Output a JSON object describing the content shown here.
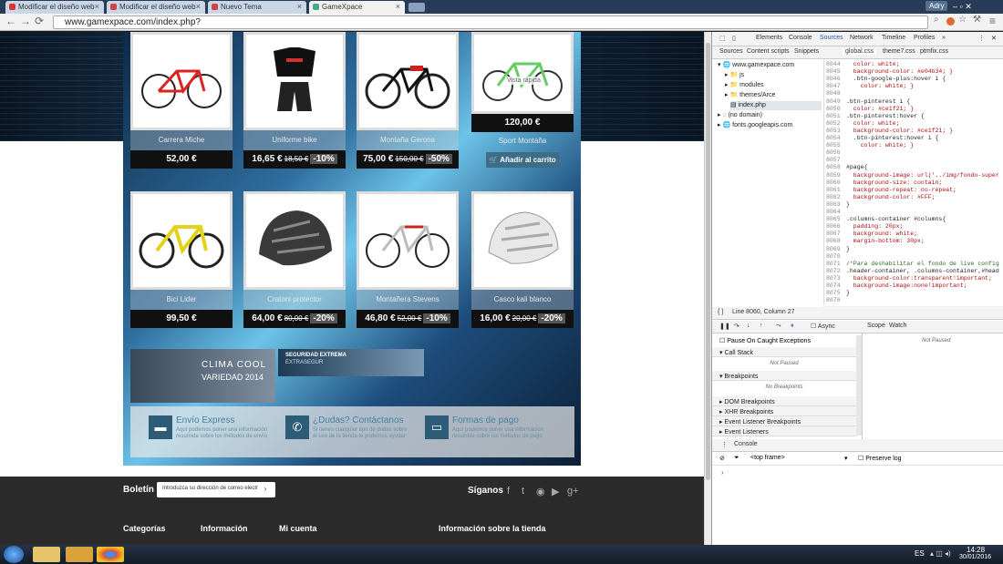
{
  "browser": {
    "tabs": [
      "Modificar el diseño web",
      "Modificar el diseño web",
      "Nuevo Tema",
      "GameXpace"
    ],
    "url": "www.gamexpace.com/index.php?",
    "user": "Adry"
  },
  "products_row1": [
    {
      "name": "Carrera Miche",
      "price": "52,00 €",
      "old": "",
      "discount": ""
    },
    {
      "name": "Uniforme bike",
      "price": "16,65 €",
      "old": "18,50 €",
      "discount": "-10%"
    },
    {
      "name": "Montaña Gerona",
      "price": "75,00 €",
      "old": "150,00 €",
      "discount": "-50%"
    },
    {
      "name": "Sport Montaña",
      "price": "120,00 €",
      "old": "",
      "discount": "",
      "hover_label": "Vista rápida",
      "cart": "Añadir al carrito"
    }
  ],
  "products_row2": [
    {
      "name": "Bici Lider",
      "price": "99,50 €",
      "old": "",
      "discount": ""
    },
    {
      "name": "Cratoni protector",
      "price": "64,00 €",
      "old": "80,00 €",
      "discount": "-20%"
    },
    {
      "name": "Montañera Stevens",
      "price": "46,80 €",
      "old": "52,00 €",
      "discount": "-10%"
    },
    {
      "name": "Casco kali blanco",
      "price": "16,00 €",
      "old": "20,00 €",
      "discount": "-20%"
    }
  ],
  "banners": {
    "b1_title": "CLIMA COOL",
    "b1_sub": "VARIEDAD 2014",
    "b2_title": "SEGURIDAD EXTREMA",
    "b2_sub": "EXTRASEGUR"
  },
  "services": [
    {
      "title": "Envío Express",
      "desc": "Aquí podemos poner una información resumida sobre los métodos de envío"
    },
    {
      "title": "¿Dudas? Contáctanos",
      "desc": "Si tienes cualquier tipo de dudas sobre el uso de la tienda te podemos ayudar"
    },
    {
      "title": "Formas de pago",
      "desc": "Aquí podemos poner una información resumida sobre los métodos de pago"
    }
  ],
  "footer": {
    "newsletter": "Boletín",
    "newsletter_placeholder": "Introduzca su dirección de correo electr",
    "follow": "Síganos",
    "cols": [
      "Categorías",
      "Información",
      "Mi cuenta",
      "Información sobre la tienda"
    ]
  },
  "devtools": {
    "tabs": [
      "Elements",
      "Console",
      "Sources",
      "Network",
      "Timeline",
      "Profiles"
    ],
    "subtabs": [
      "Sources",
      "Content scripts",
      "Snippets"
    ],
    "files": [
      "global.css",
      "theme7.css",
      "ptmfix.css"
    ],
    "tree": [
      "www.gamexpace.com",
      "js",
      "modules",
      "themes/Arce",
      "index.php",
      "(no domain)",
      "fonts.googleapis.com"
    ],
    "code": [
      [
        "8044",
        "  color: white;"
      ],
      [
        "8045",
        "  background-color: #e04b34; }"
      ],
      [
        "8046",
        "  .btn-google-plus:hover i {"
      ],
      [
        "8047",
        "    color: white; }"
      ],
      [
        "8048",
        ""
      ],
      [
        "8049",
        ".btn-pinterest i {"
      ],
      [
        "8050",
        "  color: #ce1f21; }"
      ],
      [
        "8051",
        ".btn-pinterest:hover {"
      ],
      [
        "8052",
        "  color: white;"
      ],
      [
        "8053",
        "  background-color: #ce1f21; }"
      ],
      [
        "8054",
        "  .btn-pinterest:hover i {"
      ],
      [
        "8055",
        "    color: white; }"
      ],
      [
        "8056",
        ""
      ],
      [
        "8057",
        ""
      ],
      [
        "8058",
        "#page{"
      ],
      [
        "8059",
        "  background-image: url('../img/fondo-super"
      ],
      [
        "8060",
        "  background-size: contain;"
      ],
      [
        "8061",
        "  background-repeat: no-repeat;"
      ],
      [
        "8062",
        "  background-color: #FFF;"
      ],
      [
        "8063",
        "}"
      ],
      [
        "8064",
        ""
      ],
      [
        "8065",
        ".columns-container #columns{"
      ],
      [
        "8066",
        "  padding: 20px;"
      ],
      [
        "8067",
        "  background: white;"
      ],
      [
        "8068",
        "  margin-bottom: 30px;"
      ],
      [
        "8069",
        "}"
      ],
      [
        "8070",
        ""
      ],
      [
        "8071",
        "/*Para deshabilitar el fondo de live config"
      ],
      [
        "8072",
        ".header-container, .columns-container,#head"
      ],
      [
        "8073",
        "  background-color:transparent!important;"
      ],
      [
        "8074",
        "  background-image:none!important;"
      ],
      [
        "8075",
        "}"
      ],
      [
        "8076",
        ""
      ]
    ],
    "status": "Line 8060, Column 27",
    "async": "Async",
    "scope": "Scope",
    "watch": "Watch",
    "not_paused": "Not Paused",
    "pause_exc": "Pause On Caught Exceptions",
    "sections": [
      "Call Stack",
      "Breakpoints",
      "DOM Breakpoints",
      "XHR Breakpoints",
      "Event Listener Breakpoints",
      "Event Listeners"
    ],
    "no_bp": "No Breakpoints",
    "console": "Console",
    "top_frame": "<top frame>",
    "preserve": "Preserve log"
  },
  "taskbar": {
    "lang": "ES",
    "time": "14:28",
    "date": "30/01/2016"
  }
}
